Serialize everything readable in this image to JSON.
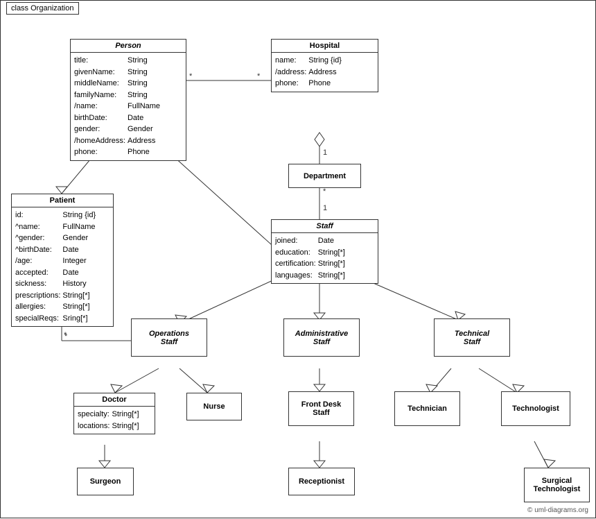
{
  "diagram": {
    "title": "class Organization",
    "classes": {
      "person": {
        "name": "Person",
        "italic": true,
        "fields": [
          [
            "title:",
            "String"
          ],
          [
            "givenName:",
            "String"
          ],
          [
            "middleName:",
            "String"
          ],
          [
            "familyName:",
            "String"
          ],
          [
            "/name:",
            "FullName"
          ],
          [
            "birthDate:",
            "Date"
          ],
          [
            "gender:",
            "Gender"
          ],
          [
            "/homeAddress:",
            "Address"
          ],
          [
            "phone:",
            "Phone"
          ]
        ]
      },
      "hospital": {
        "name": "Hospital",
        "italic": false,
        "fields": [
          [
            "name:",
            "String {id}"
          ],
          [
            "/address:",
            "Address"
          ],
          [
            "phone:",
            "Phone"
          ]
        ]
      },
      "department": {
        "name": "Department",
        "italic": false,
        "fields": []
      },
      "staff": {
        "name": "Staff",
        "italic": true,
        "fields": [
          [
            "joined:",
            "Date"
          ],
          [
            "education:",
            "String[*]"
          ],
          [
            "certification:",
            "String[*]"
          ],
          [
            "languages:",
            "String[*]"
          ]
        ]
      },
      "patient": {
        "name": "Patient",
        "italic": false,
        "fields": [
          [
            "id:",
            "String {id}"
          ],
          [
            "^name:",
            "FullName"
          ],
          [
            "^gender:",
            "Gender"
          ],
          [
            "^birthDate:",
            "Date"
          ],
          [
            "/age:",
            "Integer"
          ],
          [
            "accepted:",
            "Date"
          ],
          [
            "sickness:",
            "History"
          ],
          [
            "prescriptions:",
            "String[*]"
          ],
          [
            "allergies:",
            "String[*]"
          ],
          [
            "specialReqs:",
            "Sring[*]"
          ]
        ]
      },
      "operations_staff": {
        "name": "Operations\nStaff",
        "italic": true
      },
      "administrative_staff": {
        "name": "Administrative\nStaff",
        "italic": true
      },
      "technical_staff": {
        "name": "Technical\nStaff",
        "italic": true
      },
      "doctor": {
        "name": "Doctor",
        "italic": false,
        "fields": [
          [
            "specialty:",
            "String[*]"
          ],
          [
            "locations:",
            "String[*]"
          ]
        ]
      },
      "nurse": {
        "name": "Nurse",
        "italic": false
      },
      "front_desk_staff": {
        "name": "Front Desk\nStaff",
        "italic": false
      },
      "technician": {
        "name": "Technician",
        "italic": false
      },
      "technologist": {
        "name": "Technologist",
        "italic": false
      },
      "surgeon": {
        "name": "Surgeon",
        "italic": false
      },
      "receptionist": {
        "name": "Receptionist",
        "italic": false
      },
      "surgical_technologist": {
        "name": "Surgical\nTechnologist",
        "italic": false
      }
    },
    "copyright": "© uml-diagrams.org"
  }
}
